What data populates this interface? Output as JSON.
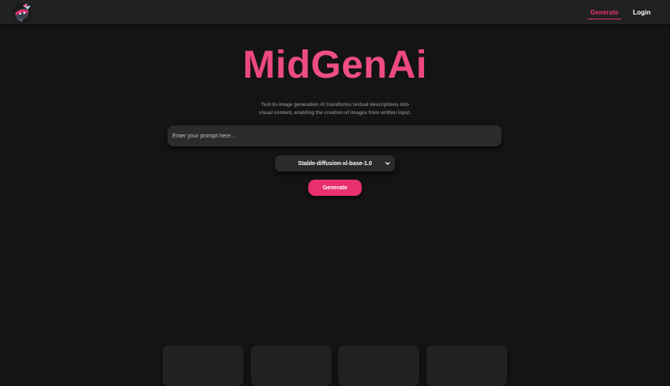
{
  "navbar": {
    "logo_icon": "ninja-mask-logo-icon",
    "links": [
      {
        "label": "Generate",
        "active": true
      },
      {
        "label": "Login",
        "active": false
      }
    ]
  },
  "hero": {
    "title": "MidGenAi",
    "description": "Text-to-image generation AI transforms textual descriptions into visual content, enabling the creation of images from written input."
  },
  "prompt": {
    "placeholder": "Enter your prompt here...",
    "value": ""
  },
  "model_select": {
    "selected": "Stable-diffusion-xl-base-1.0",
    "icon": "chevron-down-icon"
  },
  "generate_button": {
    "label": "Generate"
  },
  "colors": {
    "accent": "#e8306f",
    "background": "#141414",
    "navbar": "#212121",
    "surface": "#2b2b2b"
  }
}
